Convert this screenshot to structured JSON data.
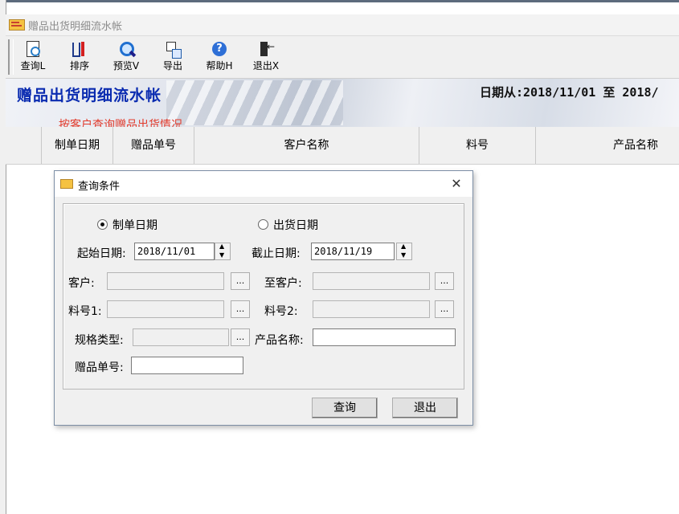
{
  "window": {
    "title": "赠品出货明细流水帐"
  },
  "toolbar": {
    "buttons": [
      {
        "label": "查询L",
        "icon": "magnifier-page-icon"
      },
      {
        "label": "排序",
        "icon": "sort-icon"
      },
      {
        "label": "预览V",
        "icon": "magnifier-icon"
      },
      {
        "label": "导出",
        "icon": "export-icon"
      },
      {
        "label": "帮助H",
        "icon": "help-icon"
      },
      {
        "label": "退出X",
        "icon": "exit-door-icon"
      }
    ]
  },
  "banner": {
    "title": "赠品出货明细流水帐",
    "date_range": "日期从:2018/11/01 至 2018/",
    "note": "按客户查询赠品出货情况"
  },
  "grid": {
    "columns": [
      "制单日期",
      "赠品单号",
      "客户名称",
      "料号",
      "产品名称"
    ]
  },
  "dialog": {
    "title": "查询条件",
    "close": "✕",
    "radio_options": [
      {
        "label": "制单日期",
        "selected": true
      },
      {
        "label": "出货日期",
        "selected": false
      }
    ],
    "start_date_label": "起始日期:",
    "start_date": "2018/11/01",
    "end_date_label": "截止日期:",
    "end_date": "2018/11/19",
    "customer_label": "客户:",
    "customer_value": "",
    "to_customer_label": "至客户:",
    "to_customer_value": "",
    "part1_label": "料号1:",
    "part1_value": "",
    "part2_label": "料号2:",
    "part2_value": "",
    "spec_type_label": "规格类型:",
    "spec_type_value": "",
    "product_name_label": "产品名称:",
    "product_name_value": "",
    "gift_no_label": "赠品单号:",
    "gift_no_value": "",
    "ellipsis": "...",
    "query_button": "查询",
    "exit_button": "退出"
  },
  "colors": {
    "banner_title": "#0a2bb0",
    "banner_note": "#e23b2b"
  }
}
